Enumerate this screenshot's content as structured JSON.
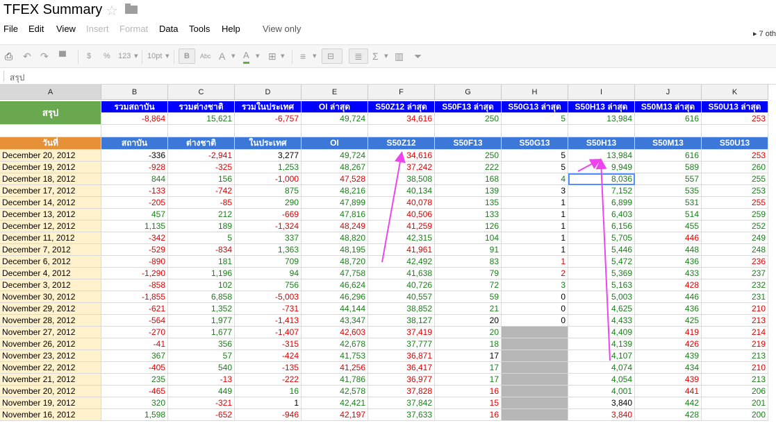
{
  "app": {
    "title": "TFEX Summary",
    "others": "7 oth"
  },
  "menu": {
    "file": "File",
    "edit": "Edit",
    "view": "View",
    "insert": "Insert",
    "format": "Format",
    "data": "Data",
    "tools": "Tools",
    "help": "Help",
    "view_only": "View only"
  },
  "toolbar": {
    "currency": "$",
    "percent": "%",
    "number_format": "123",
    "font_size": "10pt",
    "bold": "B",
    "strikethrough": "Abc",
    "text_color": "A",
    "fill_color": "A",
    "sum": "Σ"
  },
  "formula_bar": {
    "content": "สรุป"
  },
  "columns": [
    "A",
    "B",
    "C",
    "D",
    "E",
    "F",
    "G",
    "H",
    "I",
    "J",
    "K"
  ],
  "row_heights": null,
  "summary": {
    "label": "สรุป",
    "headers": [
      "รวมสถาบัน",
      "รวมต่างชาติ",
      "รวมในประเทศ",
      "OI ล่าสุด",
      "S50Z12 ล่าสุด",
      "S50F13 ล่าสุด",
      "S50G13 ล่าสุด",
      "S50H13 ล่าสุด",
      "S50M13 ล่าสุด",
      "S50U13 ล่าสุด"
    ],
    "values": [
      "-8,864",
      "15,621",
      "-6,757",
      "49,724",
      "34,616",
      "250",
      "5",
      "13,984",
      "616",
      "253"
    ]
  },
  "table": {
    "headers": [
      "วันที่",
      "สถาบัน",
      "ต่างชาติ",
      "ในประเทศ",
      "OI",
      "S50Z12",
      "S50F13",
      "S50G13",
      "S50H13",
      "S50M13",
      "S50U13"
    ],
    "rows": [
      [
        "December 20, 2012",
        "-336",
        "-2,941",
        "3,277",
        "49,724",
        "34,616",
        "250",
        "5",
        "13,984",
        "616",
        "253"
      ],
      [
        "December 19, 2012",
        "-928",
        "-325",
        "1,253",
        "48,267",
        "37,242",
        "222",
        "5",
        "9,949",
        "589",
        "260"
      ],
      [
        "December 18, 2012",
        "844",
        "156",
        "-1,000",
        "47,528",
        "38,508",
        "168",
        "4",
        "8,036",
        "557",
        "255"
      ],
      [
        "December 17, 2012",
        "-133",
        "-742",
        "875",
        "48,216",
        "40,134",
        "139",
        "3",
        "7,152",
        "535",
        "253"
      ],
      [
        "December 14, 2012",
        "-205",
        "-85",
        "290",
        "47,899",
        "40,078",
        "135",
        "1",
        "6,899",
        "531",
        "255"
      ],
      [
        "December 13, 2012",
        "457",
        "212",
        "-669",
        "47,816",
        "40,506",
        "133",
        "1",
        "6,403",
        "514",
        "259"
      ],
      [
        "December 12, 2012",
        "1,135",
        "189",
        "-1,324",
        "48,249",
        "41,259",
        "126",
        "1",
        "6,156",
        "455",
        "252"
      ],
      [
        "December 11, 2012",
        "-342",
        "5",
        "337",
        "48,820",
        "42,315",
        "104",
        "1",
        "5,705",
        "446",
        "249"
      ],
      [
        "December 7, 2012",
        "-529",
        "-834",
        "1,363",
        "48,195",
        "41,961",
        "91",
        "1",
        "5,446",
        "448",
        "248"
      ],
      [
        "December 6, 2012",
        "-890",
        "181",
        "709",
        "48,720",
        "42,492",
        "83",
        "1",
        "5,472",
        "436",
        "236"
      ],
      [
        "December 4, 2012",
        "-1,290",
        "1,196",
        "94",
        "47,758",
        "41,638",
        "79",
        "2",
        "5,369",
        "433",
        "237"
      ],
      [
        "December 3, 2012",
        "-858",
        "102",
        "756",
        "46,624",
        "40,726",
        "72",
        "3",
        "5,163",
        "428",
        "232"
      ],
      [
        "November 30, 2012",
        "-1,855",
        "6,858",
        "-5,003",
        "46,296",
        "40,557",
        "59",
        "0",
        "5,003",
        "446",
        "231"
      ],
      [
        "November 29, 2012",
        "-621",
        "1,352",
        "-731",
        "44,144",
        "38,852",
        "21",
        "0",
        "4,625",
        "436",
        "210"
      ],
      [
        "November 28, 2012",
        "-564",
        "1,977",
        "-1,413",
        "43,347",
        "38,127",
        "20",
        "0",
        "4,433",
        "425",
        "213"
      ],
      [
        "November 27, 2012",
        "-270",
        "1,677",
        "-1,407",
        "42,603",
        "37,419",
        "20",
        "",
        "4,409",
        "419",
        "214"
      ],
      [
        "November 26, 2012",
        "-41",
        "356",
        "-315",
        "42,678",
        "37,777",
        "18",
        "",
        "4,139",
        "426",
        "219"
      ],
      [
        "November 23, 2012",
        "367",
        "57",
        "-424",
        "41,753",
        "36,871",
        "17",
        "",
        "4,107",
        "439",
        "213"
      ],
      [
        "November 22, 2012",
        "-405",
        "540",
        "-135",
        "41,256",
        "36,417",
        "17",
        "",
        "4,074",
        "434",
        "210"
      ],
      [
        "November 21, 2012",
        "235",
        "-13",
        "-222",
        "41,786",
        "36,977",
        "17",
        "",
        "4,054",
        "439",
        "213"
      ],
      [
        "November 20, 2012",
        "-465",
        "449",
        "16",
        "42,578",
        "37,828",
        "16",
        "",
        "4,001",
        "441",
        "206"
      ],
      [
        "November 19, 2012",
        "320",
        "-321",
        "1",
        "42,421",
        "37,842",
        "15",
        "",
        "3,840",
        "442",
        "201"
      ],
      [
        "November 16, 2012",
        "1,598",
        "-652",
        "-946",
        "42,197",
        "37,633",
        "16",
        "",
        "3,840",
        "428",
        "200"
      ]
    ],
    "colors": [
      [
        "",
        "pos",
        "neg",
        "pos",
        "grn",
        "neg",
        "grn",
        "pos",
        "grn",
        "grn",
        "neg"
      ],
      [
        "",
        "neg",
        "neg",
        "grn",
        "grn",
        "neg",
        "grn",
        "pos",
        "grn",
        "grn",
        "grn"
      ],
      [
        "",
        "grn",
        "grn",
        "neg",
        "neg",
        "grn",
        "grn",
        "grn",
        "grn",
        "grn",
        "grn"
      ],
      [
        "",
        "neg",
        "neg",
        "grn",
        "grn",
        "grn",
        "grn",
        "pos",
        "grn",
        "grn",
        "grn"
      ],
      [
        "",
        "neg",
        "neg",
        "grn",
        "grn",
        "neg",
        "grn",
        "pos",
        "grn",
        "grn",
        "neg"
      ],
      [
        "",
        "grn",
        "grn",
        "neg",
        "grn",
        "neg",
        "grn",
        "pos",
        "grn",
        "grn",
        "grn"
      ],
      [
        "",
        "grn",
        "grn",
        "neg",
        "neg",
        "neg",
        "grn",
        "pos",
        "grn",
        "grn",
        "grn"
      ],
      [
        "",
        "neg",
        "grn",
        "grn",
        "grn",
        "grn",
        "grn",
        "pos",
        "grn",
        "neg",
        "grn"
      ],
      [
        "",
        "neg",
        "neg",
        "grn",
        "grn",
        "neg",
        "grn",
        "pos",
        "grn",
        "grn",
        "grn"
      ],
      [
        "",
        "neg",
        "grn",
        "grn",
        "grn",
        "grn",
        "grn",
        "neg",
        "grn",
        "grn",
        "neg"
      ],
      [
        "",
        "neg",
        "grn",
        "grn",
        "grn",
        "grn",
        "grn",
        "neg",
        "grn",
        "grn",
        "grn"
      ],
      [
        "",
        "neg",
        "grn",
        "grn",
        "grn",
        "grn",
        "grn",
        "grn",
        "grn",
        "neg",
        "grn"
      ],
      [
        "",
        "neg",
        "grn",
        "neg",
        "grn",
        "grn",
        "grn",
        "pos",
        "grn",
        "grn",
        "grn"
      ],
      [
        "",
        "neg",
        "grn",
        "neg",
        "grn",
        "grn",
        "grn",
        "pos",
        "grn",
        "grn",
        "neg"
      ],
      [
        "",
        "neg",
        "grn",
        "neg",
        "grn",
        "grn",
        "pos",
        "pos",
        "grn",
        "grn",
        "neg"
      ],
      [
        "",
        "neg",
        "grn",
        "neg",
        "neg",
        "neg",
        "grn",
        "",
        "grn",
        "neg",
        "neg"
      ],
      [
        "",
        "neg",
        "grn",
        "neg",
        "grn",
        "grn",
        "grn",
        "",
        "grn",
        "neg",
        "neg"
      ],
      [
        "",
        "grn",
        "grn",
        "neg",
        "grn",
        "neg",
        "pos",
        "",
        "grn",
        "grn",
        "grn"
      ],
      [
        "",
        "neg",
        "grn",
        "neg",
        "neg",
        "neg",
        "grn",
        "",
        "grn",
        "grn",
        "neg"
      ],
      [
        "",
        "grn",
        "neg",
        "neg",
        "grn",
        "neg",
        "grn",
        "",
        "grn",
        "neg",
        "grn"
      ],
      [
        "",
        "neg",
        "grn",
        "grn",
        "grn",
        "neg",
        "neg",
        "",
        "grn",
        "neg",
        "grn"
      ],
      [
        "",
        "grn",
        "neg",
        "pos",
        "grn",
        "grn",
        "neg",
        "",
        "pos",
        "grn",
        "grn"
      ],
      [
        "",
        "grn",
        "neg",
        "neg",
        "neg",
        "grn",
        "neg",
        "",
        "neg",
        "grn",
        "grn"
      ]
    ]
  },
  "colors": {
    "summary_label_bg": "#6aa84f",
    "summary_header_bg": "#0000ff",
    "date_header_bg": "#e69138",
    "table_header_bg": "#3c78d8",
    "date_cell_bg": "#fff2cc",
    "negative": "#e00000",
    "positive": "#1a7e1a",
    "annotation_arrow": "#ee44ee"
  }
}
